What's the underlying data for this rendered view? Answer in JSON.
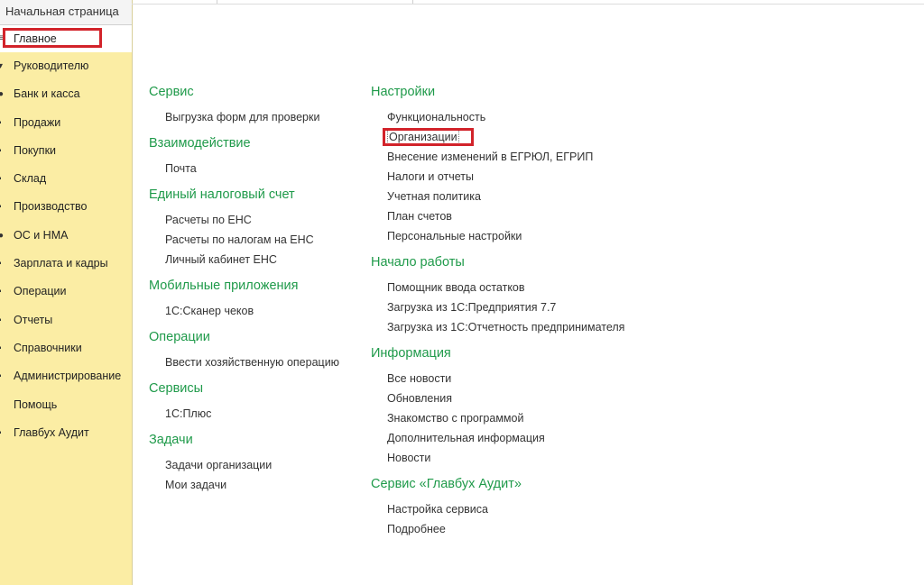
{
  "sidebar": {
    "home_tab": "Начальная страница",
    "items": [
      {
        "label": "Главное",
        "glyph": "≡",
        "active": true
      },
      {
        "label": "Руководителю",
        "glyph": "▾"
      },
      {
        "label": "Банк и касса",
        "glyph": "●"
      },
      {
        "label": "Продажи",
        "glyph": "▪"
      },
      {
        "label": "Покупки",
        "glyph": "▪"
      },
      {
        "label": "Склад",
        "glyph": "▪"
      },
      {
        "label": "Производство",
        "glyph": "▪"
      },
      {
        "label": "ОС и НМА",
        "glyph": "●"
      },
      {
        "label": "Зарплата и кадры",
        "glyph": "▪"
      },
      {
        "label": "Операции",
        "glyph": "▪"
      },
      {
        "label": "Отчеты",
        "glyph": "▪"
      },
      {
        "label": "Справочники",
        "glyph": "▪"
      },
      {
        "label": "Администрирование",
        "glyph": "▪"
      },
      {
        "label": "Помощь",
        "glyph": ""
      },
      {
        "label": "Главбух Аудит",
        "glyph": "▪"
      }
    ]
  },
  "content": {
    "left_sections": [
      {
        "title": "Сервис",
        "links": [
          "Выгрузка форм для проверки"
        ]
      },
      {
        "title": "Взаимодействие",
        "links": [
          "Почта"
        ]
      },
      {
        "title": "Единый налоговый счет",
        "links": [
          "Расчеты по ЕНС",
          "Расчеты по налогам на ЕНС",
          "Личный кабинет ЕНС"
        ]
      },
      {
        "title": "Мобильные приложения",
        "links": [
          "1С:Сканер чеков"
        ]
      },
      {
        "title": "Операции",
        "links": [
          "Ввести хозяйственную операцию"
        ]
      },
      {
        "title": "Сервисы",
        "links": [
          "1С:Плюс"
        ]
      },
      {
        "title": "Задачи",
        "links": [
          "Задачи организации",
          "Мои задачи"
        ]
      }
    ],
    "right_sections": [
      {
        "title": "Настройки",
        "links": [
          "Функциональность",
          "Организации",
          "Внесение изменений в ЕГРЮЛ, ЕГРИП",
          "Налоги и отчеты",
          "Учетная политика",
          "План счетов",
          "Персональные настройки"
        ],
        "highlighted_index": 1
      },
      {
        "title": "Начало работы",
        "links": [
          "Помощник ввода остатков",
          "Загрузка из 1С:Предприятия 7.7",
          "Загрузка из 1С:Отчетность предпринимателя"
        ]
      },
      {
        "title": "Информация",
        "links": [
          "Все новости",
          "Обновления",
          "Знакомство с программой",
          "Дополнительная информация",
          "Новости"
        ]
      },
      {
        "title": "Сервис «Главбух Аудит»",
        "links": [
          "Настройка сервиса",
          "Подробнее"
        ]
      }
    ]
  },
  "colors": {
    "sidebar_bg": "#fbeda4",
    "section_title": "#1f9a4a",
    "highlight_box": "#d2232a"
  }
}
